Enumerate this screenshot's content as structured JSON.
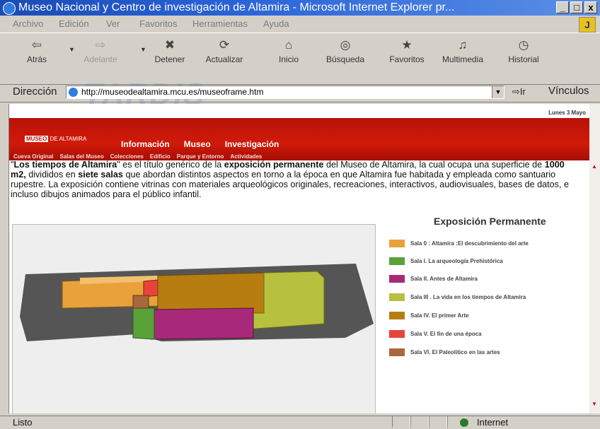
{
  "window": {
    "title": "Museo Nacional y Centro de investigación de Altamira - Microsoft Internet Explorer pr...",
    "buttons": [
      "_",
      "□",
      "x"
    ]
  },
  "menu": [
    "Archivo",
    "Edición",
    "Ver",
    "Favoritos",
    "Herramientas",
    "Ayuda"
  ],
  "toolbar": [
    {
      "label": "Atrás",
      "icon": "back-arrow-icon",
      "glyph": "⇦",
      "enabled": true
    },
    {
      "label": "Adelante",
      "icon": "forward-arrow-icon",
      "glyph": "⇨",
      "enabled": false
    },
    {
      "label": "Detener",
      "icon": "stop-icon",
      "glyph": "✖",
      "enabled": true
    },
    {
      "label": "Actualizar",
      "icon": "refresh-icon",
      "glyph": "⟳",
      "enabled": true
    },
    {
      "label": "Inicio",
      "icon": "home-icon",
      "glyph": "⌂",
      "enabled": true
    },
    {
      "label": "Búsqueda",
      "icon": "search-icon",
      "glyph": "◎",
      "enabled": true
    },
    {
      "label": "Favoritos",
      "icon": "favorites-icon",
      "glyph": "★",
      "enabled": true
    },
    {
      "label": "Multimedia",
      "icon": "multimedia-icon",
      "glyph": "♫",
      "enabled": true
    },
    {
      "label": "Historial",
      "icon": "history-icon",
      "glyph": "◷",
      "enabled": true
    }
  ],
  "address": {
    "label": "Dirección",
    "url": "http://museodealtamira.mcu.es/museoframe.htm",
    "go": "Ir",
    "links": "Vínculos"
  },
  "site": {
    "date": "Lunes 3 Mayo",
    "logo": {
      "word1": "MUSEO",
      "word2": "DE ALTAMIRA"
    },
    "nav": [
      "Información",
      "Museo",
      "Investigación"
    ],
    "subnav": [
      "Cueva Original",
      "Salas del Museo",
      "Colecciones",
      "Edificio",
      "Parque y Entorno",
      "Actividades"
    ],
    "intro": {
      "p1": "\"",
      "b1": "Los tiempos de Altamira",
      "p2": "\" es el título genérico de la ",
      "b2": "exposición permanente",
      "p3": " del Museo de Altamira, la cual ocupa una superficie de ",
      "b3": "1000 m2,",
      "p4": " divididos en ",
      "b4": "siete salas",
      "p5": " que abordan distintos aspectos en torno a la época en que Altamira fue habitada y empleada como santuario rupestre. La exposición contiene vitrinas con materiales arqueológicos originales, recreaciones, interactivos, audiovisuales, bases de datos, e incluso dibujos animados para el público infantil."
    },
    "legend_title": "Exposición Permanente",
    "legend": [
      {
        "label": "Sala 0 : Altamira :El descubrimiento del arte",
        "color": "#e8a23c"
      },
      {
        "label": "Sala I. La arqueología Prehistórica",
        "color": "#5aa13a"
      },
      {
        "label": "Sala II. Antes de Altamira",
        "color": "#a8297a"
      },
      {
        "label": "Sala III . La vida en los  tiempos de Altamira",
        "color": "#b8c040"
      },
      {
        "label": "Sala IV. El primer Arte",
        "color": "#b87d10"
      },
      {
        "label": "Sala V. El fin de una época",
        "color": "#e8453a"
      },
      {
        "label": "Sala VI. El Paleolítico en las artes",
        "color": "#a8683a"
      }
    ]
  },
  "status": {
    "text": "Listo",
    "zone": "Internet"
  }
}
